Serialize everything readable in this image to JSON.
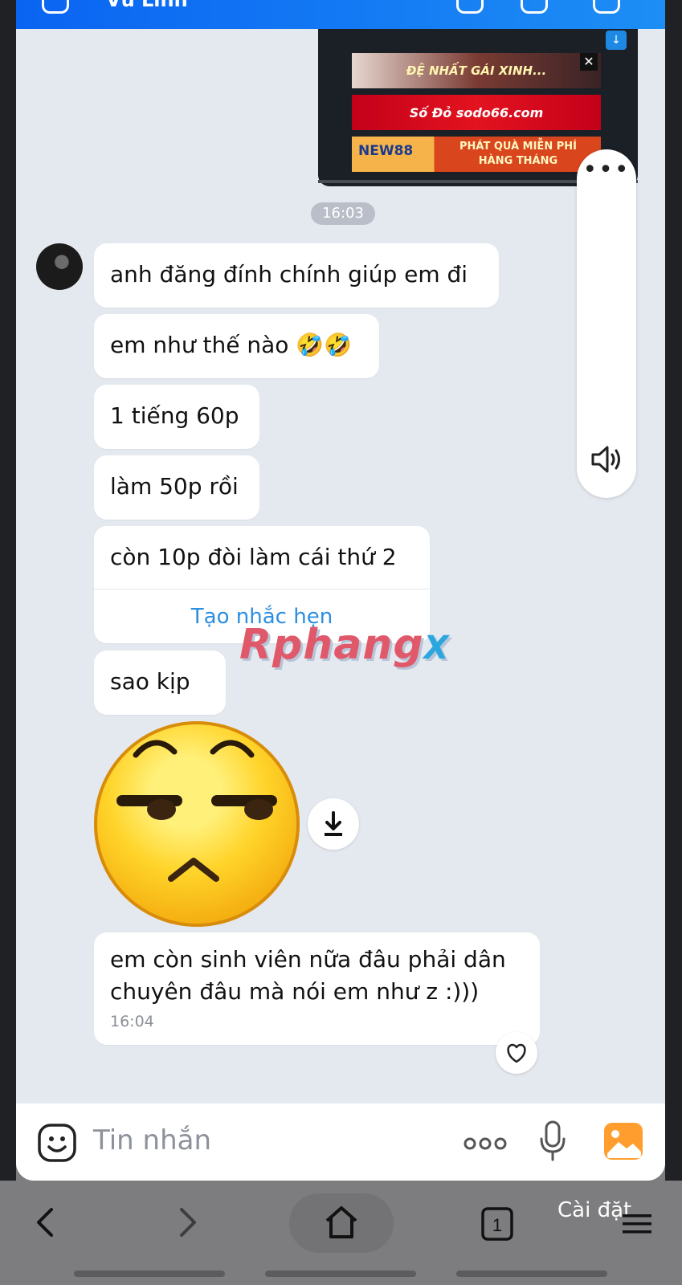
{
  "header": {
    "title": "Vũ Linh"
  },
  "video_ad": {
    "ad1_text": "ĐỆ NHẤT GÁI XINH...",
    "ad2_text": "Số Đỏ sodo66.com",
    "ad3_brand": "NEW88",
    "ad3_text": "PHÁT QUÀ MIỄN PHÍ HÀNG THÁNG",
    "close_glyph": "✕"
  },
  "time_divider": "16:03",
  "messages": [
    {
      "text": "anh đăng đính chính giúp em đi"
    },
    {
      "text": "em như thế nào 🤣🤣"
    },
    {
      "text": "1 tiếng 60p"
    },
    {
      "text": "làm 50p rồi"
    },
    {
      "text": "còn 10p đòi làm cái thứ 2",
      "action": "Tạo nhắc hẹn"
    },
    {
      "text": "sao kịp"
    },
    {
      "text": "em còn sinh viên nữa đâu phải dân\nchuyên đâu mà nói em như z :)))",
      "time": "16:04"
    }
  ],
  "watermark": {
    "main": "Rphang",
    "suffix": "X"
  },
  "sticker": {
    "icon": "smug-face-sticker"
  },
  "side_panel": {
    "more": "•••"
  },
  "input": {
    "placeholder": "Tin nhắn"
  },
  "browser": {
    "settings_label": "Cài đặt",
    "tab_count": "1"
  },
  "colors": {
    "topbar": "#0a64f2",
    "chat_bg": "#e4e8ef",
    "link": "#2c8ee0"
  }
}
